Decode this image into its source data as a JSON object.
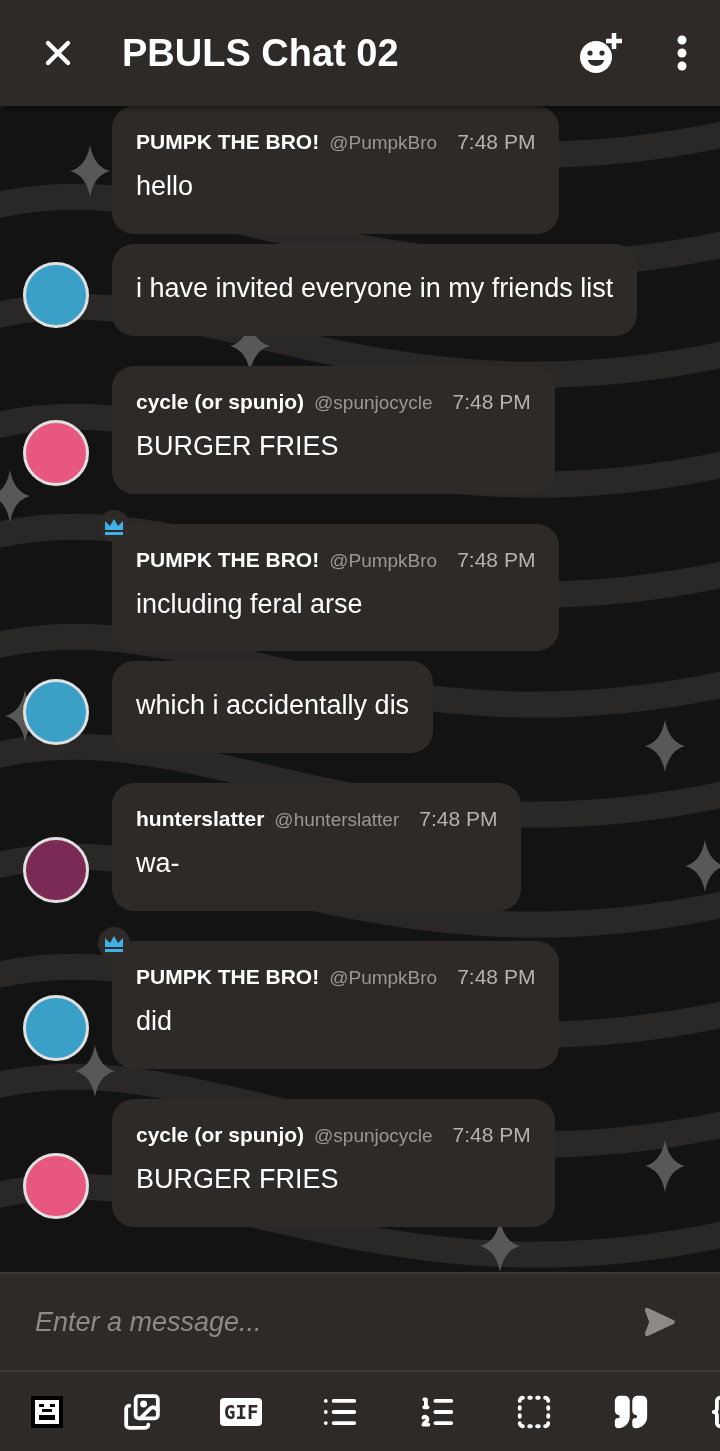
{
  "header": {
    "title": "PBULS Chat 02"
  },
  "groups": [
    {
      "author": "PUMPK THE BRO!",
      "handle": "@PumpkBro",
      "time": "7:48 PM",
      "host": false,
      "color": "#3aa0c8",
      "messages": [
        "hello",
        "i have invited everyone in my friends list"
      ]
    },
    {
      "author": "cycle (or spunjo)",
      "handle": "@spunjocycle",
      "time": "7:48 PM",
      "host": false,
      "color": "#e8577f",
      "messages": [
        "BURGER FRIES"
      ]
    },
    {
      "author": "PUMPK THE BRO!",
      "handle": "@PumpkBro",
      "time": "7:48 PM",
      "host": true,
      "color": "#3aa0c8",
      "messages": [
        "including feral arse",
        "which i accidentally dis"
      ]
    },
    {
      "author": "hunterslatter",
      "handle": "@hunterslatter",
      "time": "7:48 PM",
      "host": false,
      "color": "#7a2a55",
      "messages": [
        "wa-"
      ]
    },
    {
      "author": "PUMPK THE BRO!",
      "handle": "@PumpkBro",
      "time": "7:48 PM",
      "host": true,
      "color": "#3aa0c8",
      "messages": [
        "did"
      ]
    },
    {
      "author": "cycle (or spunjo)",
      "handle": "@spunjocycle",
      "time": "7:48 PM",
      "host": false,
      "color": "#e8577f",
      "messages": [
        "BURGER FRIES"
      ]
    }
  ],
  "composer": {
    "placeholder": "Enter a message..."
  },
  "toolbar": [
    {
      "kind": "sticker"
    },
    {
      "kind": "images"
    },
    {
      "kind": "gif",
      "label": "GIF"
    },
    {
      "kind": "bullets"
    },
    {
      "kind": "numbers"
    },
    {
      "kind": "frame"
    },
    {
      "kind": "quote"
    },
    {
      "kind": "code"
    }
  ]
}
